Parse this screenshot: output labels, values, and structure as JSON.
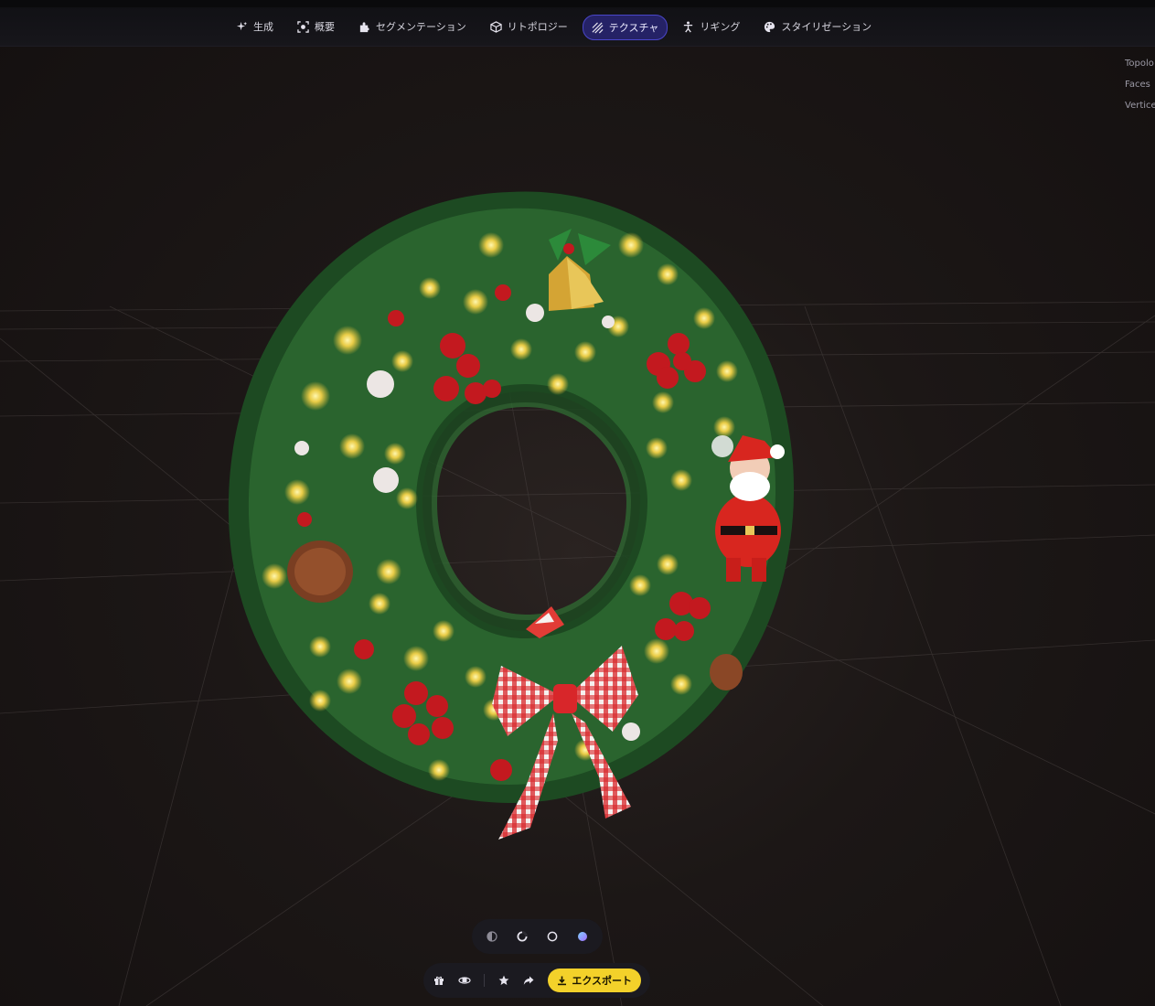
{
  "tabs": [
    {
      "label": "生成",
      "icon": "sparkle-icon"
    },
    {
      "label": "概要",
      "icon": "scan-icon"
    },
    {
      "label": "セグメンテーション",
      "icon": "puzzle-icon"
    },
    {
      "label": "リトポロジー",
      "icon": "cube-icon"
    },
    {
      "label": "テクスチャ",
      "icon": "texture-icon",
      "active": true
    },
    {
      "label": "リギング",
      "icon": "rig-figure-icon"
    },
    {
      "label": "スタイリゼーション",
      "icon": "palette-icon"
    }
  ],
  "stats": {
    "topology_label": "Topolo",
    "faces_label": "Faces",
    "vertices_label": "Vertice"
  },
  "view_modes": [
    "half-circle-icon",
    "ring-icon",
    "circle-outline-icon",
    "color-sphere-icon"
  ],
  "bottom_tools": [
    "gift-icon",
    "orbit-icon",
    "star-icon",
    "share-icon"
  ],
  "export": {
    "label": "エクスポート",
    "icon": "download-icon"
  },
  "colors": {
    "accent_active_tab": "#252266",
    "accent_active_border": "#4a46c9",
    "export_yellow": "#f3d12a",
    "background": "#171312"
  }
}
